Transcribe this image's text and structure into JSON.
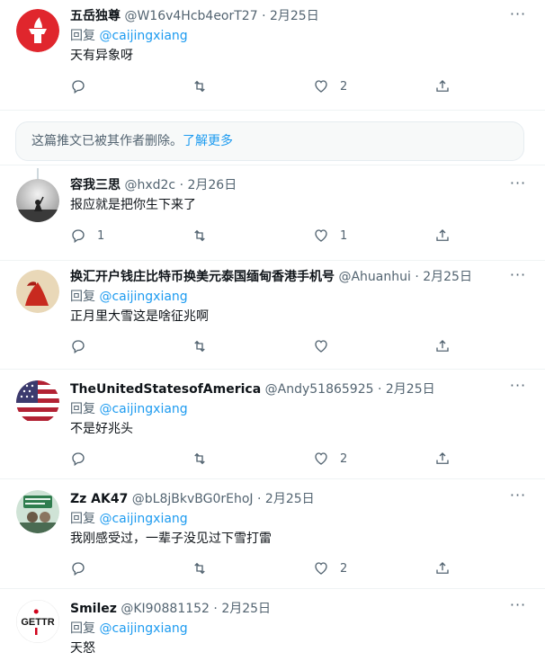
{
  "tweets_top": {
    "name": "五岳独尊",
    "handle": "@W16v4Hcb4eorT27",
    "date": "2月25日",
    "reply_prefix": "回复",
    "reply_to": "@caijingxiang",
    "text": "天有异象呀",
    "replies": "",
    "retweets": "",
    "likes": "2"
  },
  "deleted_notice": {
    "text": "这篇推文已被其作者删除。",
    "link": "了解更多"
  },
  "tweets": [
    {
      "name": "容我三思",
      "handle": "@hxd2c",
      "date": "2月26日",
      "reply_prefix": "",
      "reply_to": "",
      "text": "报应就是把你生下来了",
      "replies": "1",
      "retweets": "",
      "likes": "1"
    },
    {
      "name": "换汇开户钱庄比特币换美元泰国缅甸香港手机号",
      "handle": "@Ahuanhui",
      "date": "2月25日",
      "reply_prefix": "回复",
      "reply_to": "@caijingxiang",
      "text": "正月里大雪这是啥征兆啊",
      "replies": "",
      "retweets": "",
      "likes": ""
    },
    {
      "name": "TheUnitedStatesofAmerica",
      "handle": "@Andy51865925",
      "date": "2月25日",
      "reply_prefix": "回复",
      "reply_to": "@caijingxiang",
      "text": "不是好兆头",
      "replies": "",
      "retweets": "",
      "likes": "2"
    },
    {
      "name": "Zz AK47",
      "handle": "@bL8jBkvBG0rEhoJ",
      "date": "2月25日",
      "reply_prefix": "回复",
      "reply_to": "@caijingxiang",
      "text": "我刚感受过，一辈子没见过下雪打雷",
      "replies": "",
      "retweets": "",
      "likes": "2"
    },
    {
      "name": "Smilez",
      "handle": "@KI90881152",
      "date": "2月25日",
      "reply_prefix": "回复",
      "reply_to": "@caijingxiang",
      "text": "天怒",
      "replies": "",
      "retweets": "",
      "likes": ""
    }
  ],
  "avatars": {
    "smilez_logo_text": "GETTR"
  },
  "separator_dot": "·",
  "more_glyph": "···",
  "colors": {
    "accent": "#1d9bf0",
    "secondary_text": "#536471",
    "primary_text": "#0f1419",
    "divider": "#eff3f4"
  },
  "icons": [
    "reply-icon",
    "retweet-icon",
    "like-icon",
    "share-icon",
    "more-icon"
  ]
}
